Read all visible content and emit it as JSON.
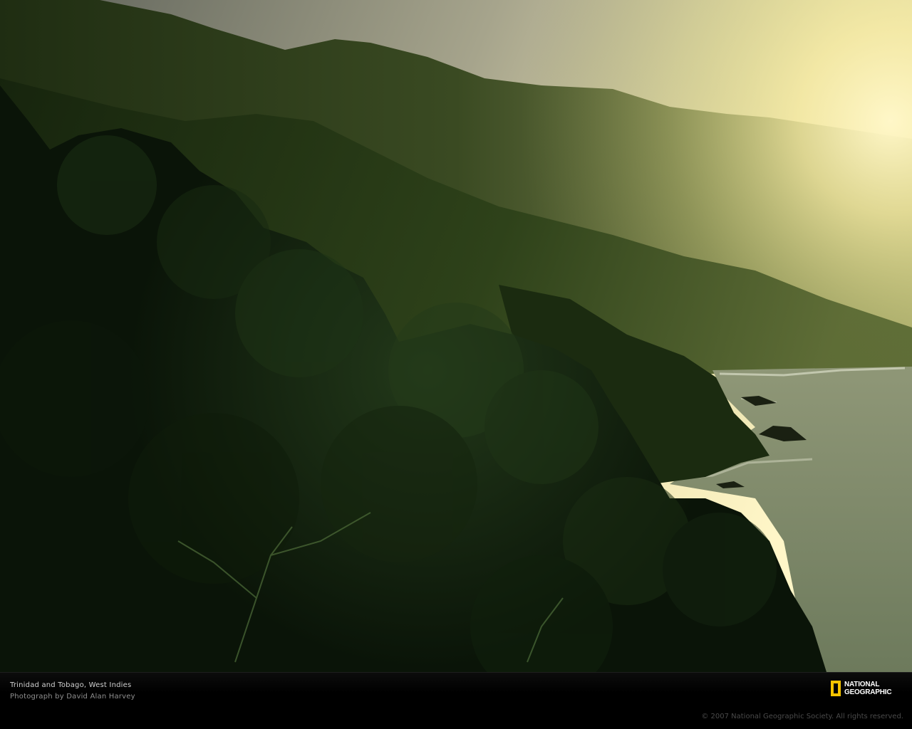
{
  "caption": {
    "title": "Trinidad and Tobago, West Indies",
    "credit": "Photograph by David Alan Harvey"
  },
  "logo": {
    "line1": "NATIONAL",
    "line2": "GEOGRAPHIC",
    "frame_color": "#f5c400"
  },
  "copyright": "© 2007 National Geographic Society. All rights reserved.",
  "colors": {
    "sky_glow": "#fff2b0",
    "haze": "#cfd088",
    "far_ridge": "#3c4d22",
    "mid_ridge": "#2a3d18",
    "foreground": "#0d1a0a",
    "sea": "#7e8868"
  }
}
